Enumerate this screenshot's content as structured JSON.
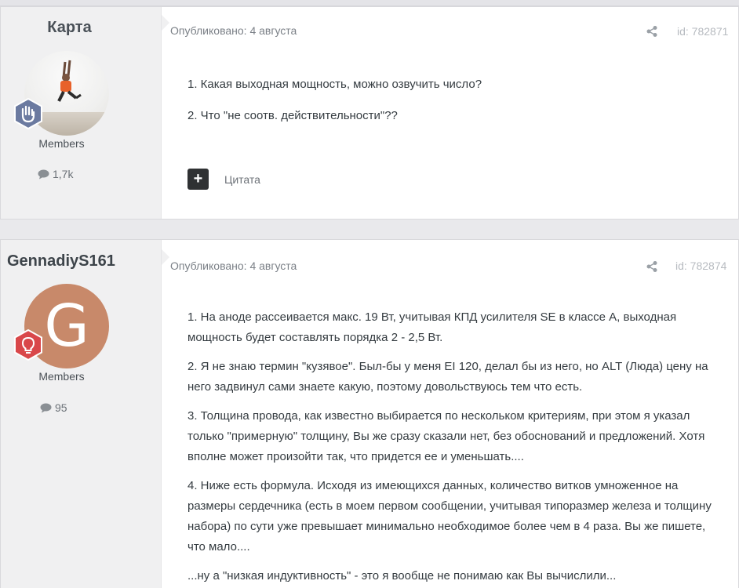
{
  "posts": [
    {
      "author": "Карта",
      "group": "Members",
      "post_count": "1,7k",
      "published": "Опубликовано: 4 августа",
      "post_id": "id: 782871",
      "paragraphs": [
        "1. Какая выходная мощность, можно озвучить число?",
        "2. Что \"не соотв. действительности\"??"
      ],
      "quote_label": "Цитата",
      "avatar_icon": "photo-jumping-man",
      "badge_icon": "hand-wave-icon",
      "badge_color": "#6b7aa0"
    },
    {
      "author": "GennadiyS161",
      "group": "Members",
      "post_count": "95",
      "published": "Опубликовано: 4 августа",
      "post_id": "id: 782874",
      "avatar_letter": "G",
      "avatar_color": "#c8896a",
      "badge_icon": "lightbulb-icon",
      "badge_color": "#d9474a",
      "paragraphs": [
        "1. На аноде рассеивается макс. 19 Вт, учитывая КПД усилителя SE в классе А, выходная мощность будет составлять порядка 2 - 2,5 Вт.",
        "2. Я не знаю термин \"кузявое\". Был-бы у меня EI 120, делал бы из него, но ALT (Люда) цену на него задвинул сами знаете какую, поэтому довольствуюсь тем что есть.",
        "3. Толщина провода, как известно выбирается по нескольком критериям, при этом я указал только \"примерную\" толщину, Вы же сразу сказали нет, без обоснований и предложений. Хотя вполне может произойти так, что придется ее и уменьшать....",
        "4.  Ниже есть формула. Исходя из имеющихся данных, количество витков умноженное на размеры сердечника (есть в моем первом сообщении, учитывая типоразмер железа и толщину набора) по сути уже превышает минимально необходимое более чем в 4 раза. Вы же пишете, что мало....",
        "...ну а \"низкая индуктивность\" - это я вообще не понимаю как Вы вычислили..."
      ]
    }
  ]
}
